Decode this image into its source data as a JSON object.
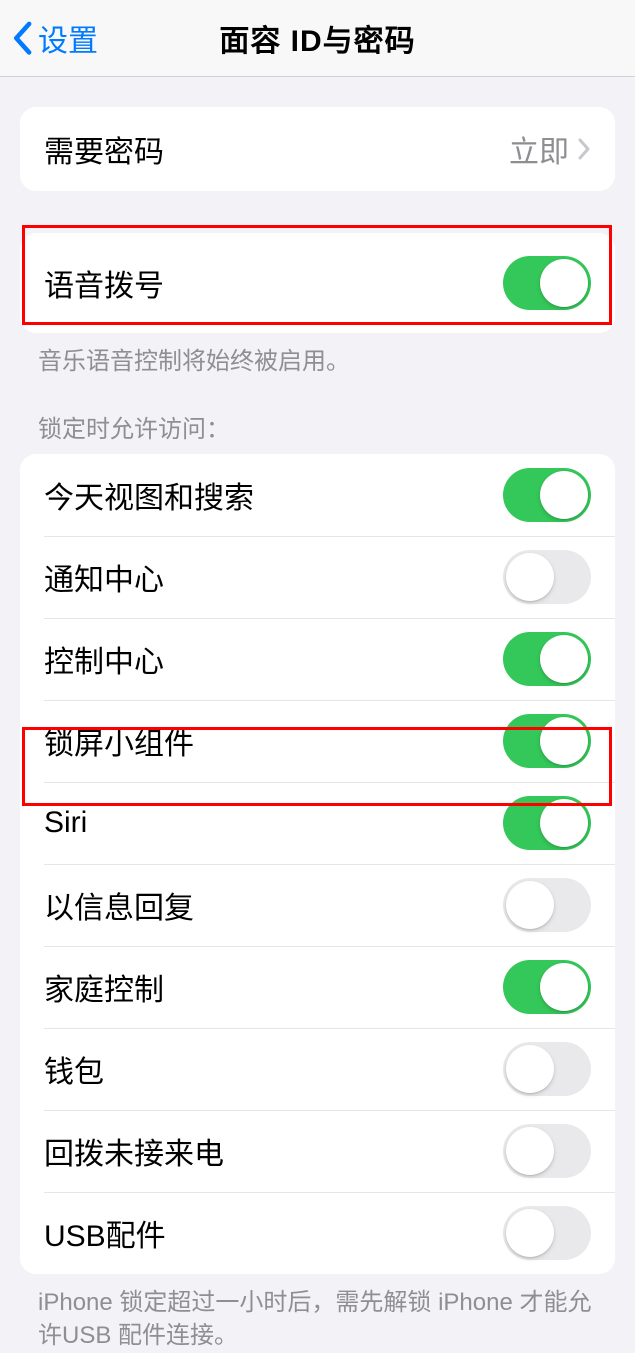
{
  "nav": {
    "back_label": "设置",
    "title": "面容 ID与密码"
  },
  "passcode": {
    "label": "需要密码",
    "value": "立即"
  },
  "voice_dial": {
    "label": "语音拨号",
    "enabled": true,
    "footer": "音乐语音控制将始终被启用。"
  },
  "lock_access": {
    "header": "锁定时允许访问：",
    "items": [
      {
        "label": "今天视图和搜索",
        "enabled": true
      },
      {
        "label": "通知中心",
        "enabled": false
      },
      {
        "label": "控制中心",
        "enabled": true
      },
      {
        "label": "锁屏小组件",
        "enabled": true
      },
      {
        "label": "Siri",
        "enabled": true
      },
      {
        "label": "以信息回复",
        "enabled": false
      },
      {
        "label": "家庭控制",
        "enabled": true
      },
      {
        "label": "钱包",
        "enabled": false
      },
      {
        "label": "回拨未接来电",
        "enabled": false
      },
      {
        "label": "USB配件",
        "enabled": false
      }
    ],
    "footer": "iPhone 锁定超过一小时后，需先解锁 iPhone 才能允许USB 配件连接。"
  }
}
